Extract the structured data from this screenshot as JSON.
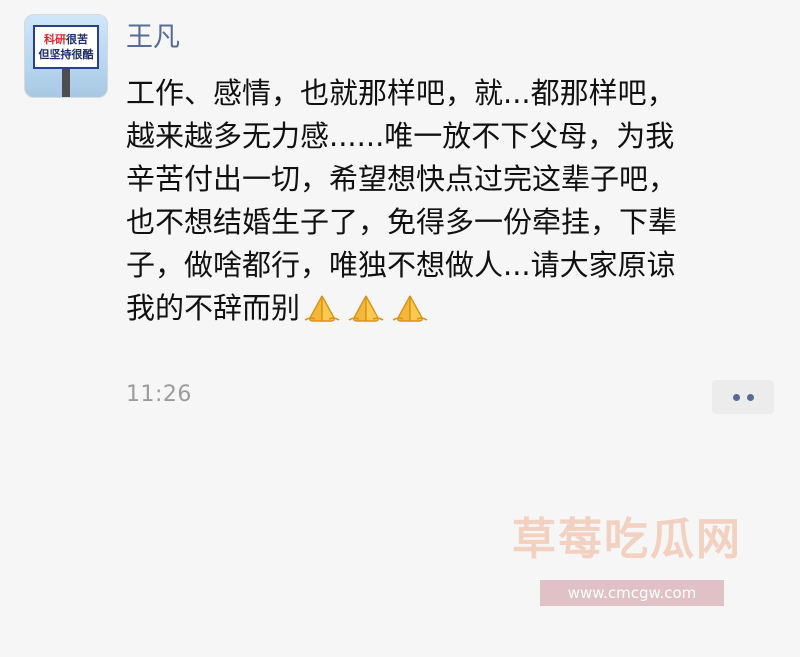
{
  "post": {
    "author": "王凡",
    "avatar_text": {
      "line1_red": "科研",
      "line1_dark": "很苦",
      "line2": "但坚持很酷"
    },
    "text": "工作、感情，也就那样吧，就...都那样吧，\n越来越多无力感......唯一放不下父母，为我\n辛苦付出一切，希望想快点过完这辈子吧，\n也不想结婚生子了，免得多一份牵挂，下辈\n子，做啥都行，唯独不想做人...请大家原谅\n我的不辞而别",
    "emojis": [
      "folded-hands-emoji",
      "folded-hands-emoji",
      "folded-hands-emoji"
    ],
    "timestamp": "11:26",
    "more_icon": "more-dots-icon"
  },
  "watermark": {
    "title": "草莓吃瓜网",
    "url": "www.cmcgw.com"
  },
  "colors": {
    "author_name": "#576b95",
    "body_text": "#111111",
    "timestamp": "#9b9b9b",
    "background": "#f6f6f6",
    "more_button_bg": "#ececec"
  }
}
